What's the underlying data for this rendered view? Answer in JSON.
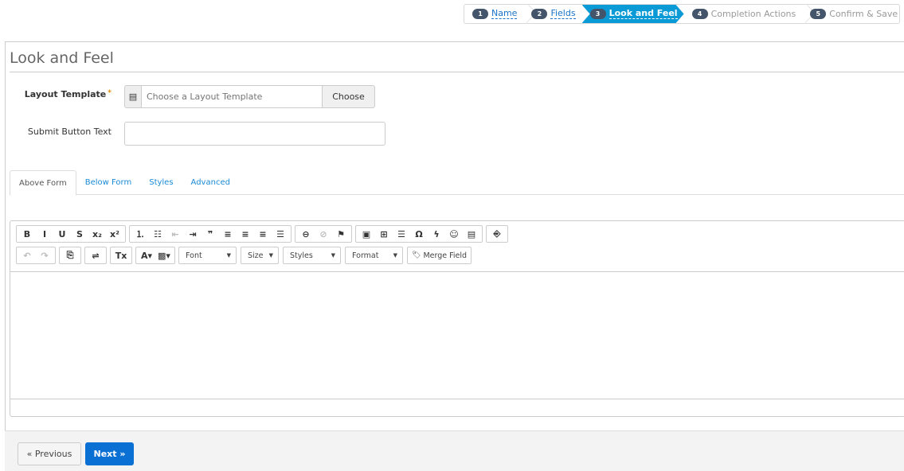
{
  "wizard": {
    "steps": [
      {
        "num": "1",
        "label": "Name",
        "state": "done"
      },
      {
        "num": "2",
        "label": "Fields",
        "state": "done"
      },
      {
        "num": "3",
        "label": "Look and Feel",
        "state": "active"
      },
      {
        "num": "4",
        "label": "Completion Actions",
        "state": "upcoming"
      },
      {
        "num": "5",
        "label": "Confirm & Save",
        "state": "upcoming"
      }
    ]
  },
  "page": {
    "title": "Look and Feel"
  },
  "form": {
    "layout_template": {
      "label": "Layout Template",
      "required": "*",
      "placeholder": "Choose a Layout Template",
      "value": "",
      "button": "Choose"
    },
    "submit_button_text": {
      "label": "Submit Button Text",
      "value": ""
    }
  },
  "tabs": [
    {
      "label": "Above Form",
      "active": true
    },
    {
      "label": "Below Form"
    },
    {
      "label": "Styles"
    },
    {
      "label": "Advanced"
    }
  ],
  "editor": {
    "toolbar_row1": [
      [
        [
          "bold",
          "B"
        ],
        [
          "italic",
          "I"
        ],
        [
          "underline",
          "U"
        ],
        [
          "strikethrough",
          "S"
        ],
        [
          "subscript",
          "x₂"
        ],
        [
          "superscript",
          "x²"
        ]
      ],
      [
        [
          "numbered-list",
          "⒈"
        ],
        [
          "bulleted-list",
          "☷"
        ],
        [
          "decrease-indent",
          "⇤",
          1
        ],
        [
          "increase-indent",
          "⇥"
        ],
        [
          "blockquote",
          "❞"
        ],
        [
          "align-left",
          "≡"
        ],
        [
          "align-center",
          "≡"
        ],
        [
          "align-right",
          "≡"
        ],
        [
          "justify",
          "☰"
        ]
      ],
      [
        [
          "link",
          "⊖"
        ],
        [
          "unlink",
          "⊘",
          1
        ],
        [
          "anchor",
          "⚑"
        ]
      ],
      [
        [
          "image",
          "▣"
        ],
        [
          "table",
          "⊞"
        ],
        [
          "horizontal-line",
          "☰"
        ],
        [
          "special-char",
          "Ω"
        ],
        [
          "flash",
          "ϟ"
        ],
        [
          "smiley",
          "☺"
        ],
        [
          "template",
          "▤"
        ]
      ],
      [
        [
          "source",
          "⎆"
        ]
      ]
    ],
    "toolbar_row2": [
      [
        [
          "undo",
          "↶",
          1
        ],
        [
          "redo",
          "↷",
          1
        ]
      ],
      [
        [
          "paste",
          "⎘"
        ]
      ],
      [
        [
          "settings",
          "⇌"
        ]
      ],
      [
        [
          "remove-format",
          "Tx"
        ]
      ],
      [
        [
          "text-color",
          "A▾"
        ],
        [
          "background-color",
          "▩▾"
        ]
      ]
    ],
    "combos": [
      "Font",
      "Size",
      "Styles",
      "Format"
    ],
    "merge_field": "Merge Field",
    "content": ""
  },
  "footer": {
    "previous": "« Previous",
    "next": "Next »"
  },
  "colors": {
    "active_step": "#0a9ad6",
    "primary": "#0b70d4",
    "link": "#1a8ad6"
  }
}
